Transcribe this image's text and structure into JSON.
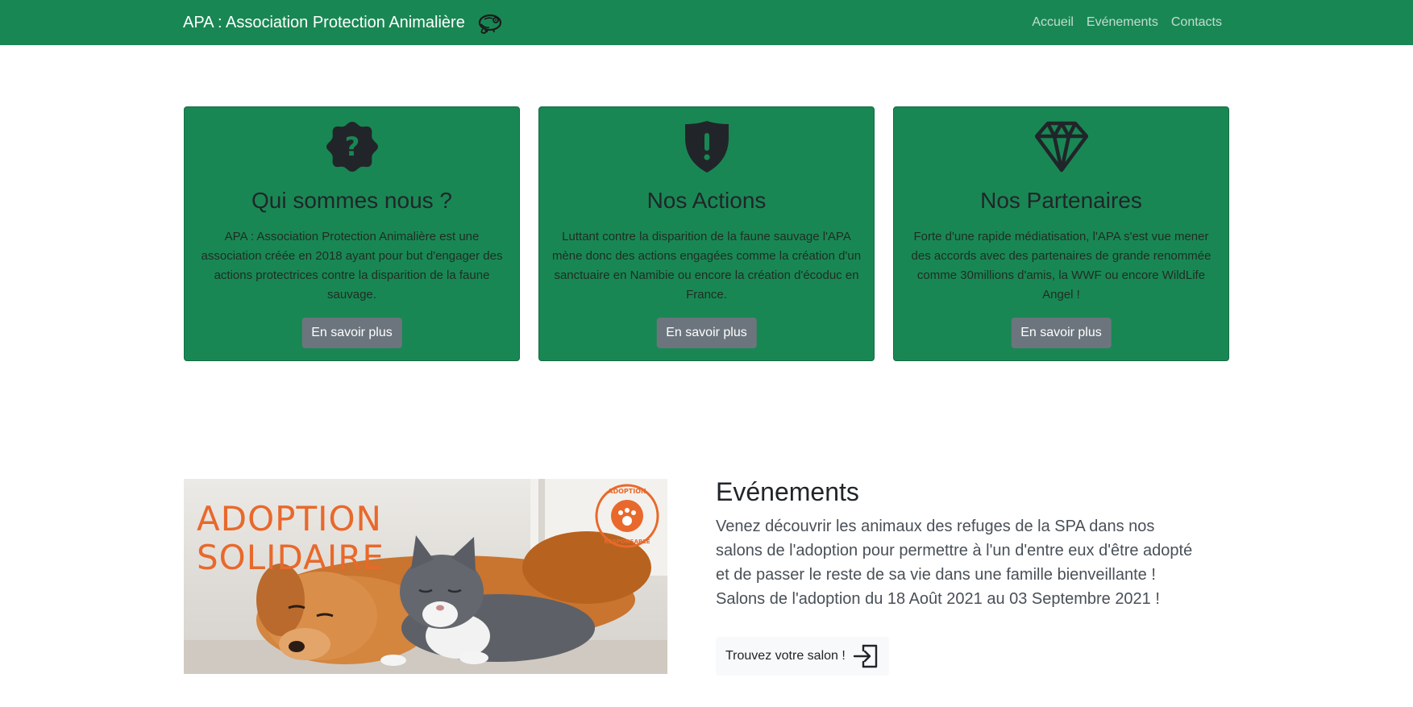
{
  "navbar": {
    "brand": "APA : Association Protection Animalière",
    "links": [
      "Accueil",
      "Evénements",
      "Contacts"
    ]
  },
  "cards": [
    {
      "icon": "question-badge-icon",
      "title": "Qui sommes nous ?",
      "text": "APA : Association Protection Animalière est une association créée en 2018 ayant pour but d'engager des actions protectrices contre la disparition de la faune sauvage.",
      "button": "En savoir plus"
    },
    {
      "icon": "shield-exclamation-icon",
      "title": "Nos Actions",
      "text": "Luttant contre la disparition de la faune sauvage l'APA mène donc des actions engagées comme la création d'un sanctuaire en Namibie ou encore la création d'écoduc en France.",
      "button": "En savoir plus"
    },
    {
      "icon": "gem-icon",
      "title": "Nos Partenaires",
      "text": "Forte d'une rapide médiatisation, l'APA s'est vue mener des accords avec des partenaires de grande renommée comme 30millions d'amis, la WWF ou encore WildLife Angel !",
      "button": "En savoir plus"
    }
  ],
  "events": {
    "image": {
      "headline_line1": "ADOPTION",
      "headline_line2": "SOLIDAIRE",
      "stamp_top": "ADOPTION",
      "stamp_bottom": "RESPONSABLE"
    },
    "title": "Evénements",
    "text": "Venez découvrir les animaux des refuges de la SPA dans nos salons de l'adoption pour permettre à l'un d'entre eux d'être adopté et de passer le reste de sa vie dans une famille bienveillante ! Salons de l'adoption du 18 Août 2021 au 03 Septembre 2021 !",
    "button": "Trouvez votre salon !",
    "button_icon": "enter-icon"
  },
  "colors": {
    "primary_green": "#198754",
    "button_gray": "#6c757d",
    "accent_orange": "#e8692b"
  }
}
